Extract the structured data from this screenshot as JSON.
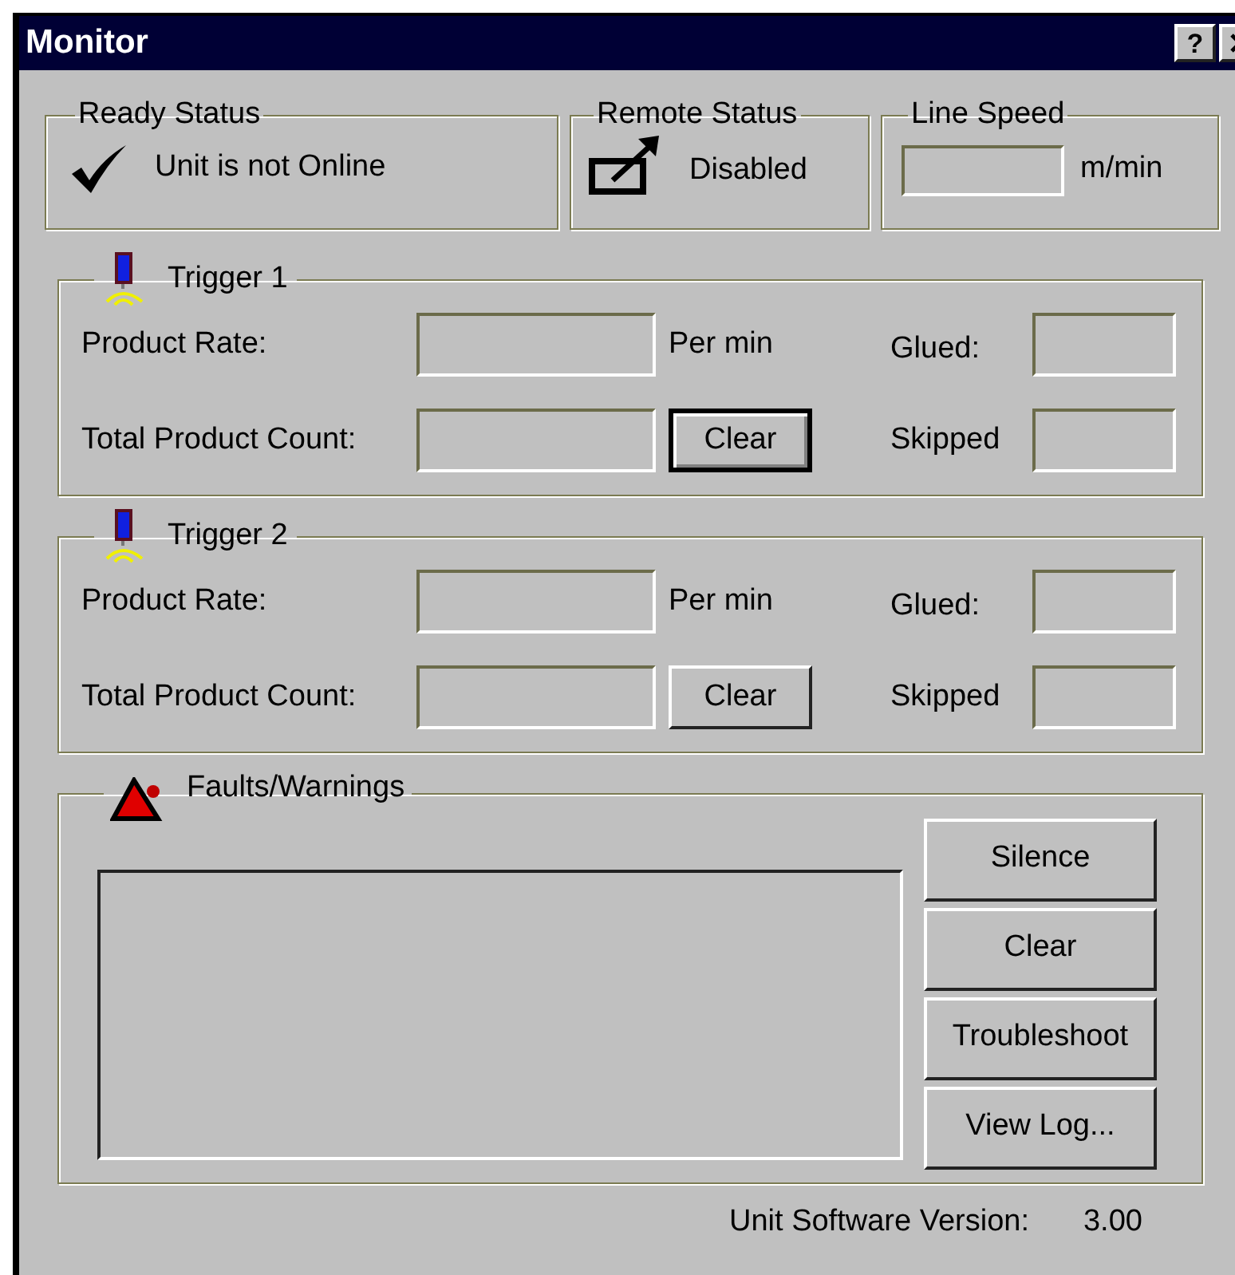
{
  "window": {
    "title": "Monitor",
    "help": "?"
  },
  "ready_status": {
    "title": "Ready Status",
    "text": "Unit is not Online"
  },
  "remote_status": {
    "title": "Remote Status",
    "text": "Disabled"
  },
  "line_speed": {
    "title": "Line Speed",
    "unit": "m/min"
  },
  "triggers": [
    {
      "title": "Trigger 1",
      "rate_label": "Product Rate:",
      "rate_unit": "Per min",
      "count_label": "Total Product Count:",
      "clear": "Clear",
      "clear_focused": true,
      "glued_label": "Glued:",
      "skipped_label": "Skipped"
    },
    {
      "title": "Trigger 2",
      "rate_label": "Product Rate:",
      "rate_unit": "Per min",
      "count_label": "Total Product Count:",
      "clear": "Clear",
      "clear_focused": false,
      "glued_label": "Glued:",
      "skipped_label": "Skipped"
    }
  ],
  "faults": {
    "title": "Faults/Warnings",
    "buttons": [
      "Silence",
      "Clear",
      "Troubleshoot",
      "View Log..."
    ]
  },
  "version": {
    "label": "Unit Software Version:",
    "value": "3.00"
  }
}
